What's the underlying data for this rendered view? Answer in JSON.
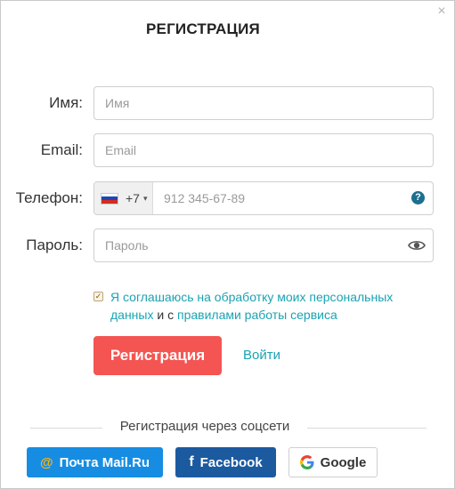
{
  "modal": {
    "title": "РЕГИСТРАЦИЯ",
    "close_icon": "×"
  },
  "form": {
    "name": {
      "label": "Имя:",
      "placeholder": "Имя",
      "value": ""
    },
    "email": {
      "label": "Email:",
      "placeholder": "Email",
      "value": ""
    },
    "phone": {
      "label": "Телефон:",
      "country_flag": "ru-flag-icon",
      "dial_code": "+7",
      "caret": "▾",
      "placeholder": "912 345-67-89",
      "value": "",
      "help_icon": "?"
    },
    "password": {
      "label": "Пароль:",
      "placeholder": "Пароль",
      "value": "",
      "toggle_icon": "eye-icon"
    }
  },
  "consent": {
    "checked": true,
    "check_mark": "✓",
    "link1": "Я соглашаюсь на обработку моих персональных данных",
    "middle": " и с ",
    "link2": "правилами работы сервиса"
  },
  "actions": {
    "register_label": "Регистрация",
    "login_label": "Войти"
  },
  "social": {
    "divider_label": "Регистрация через соцсети",
    "buttons": {
      "mailru": {
        "icon": "@",
        "label": "Почта Mail.Ru"
      },
      "facebook": {
        "icon": "f",
        "label": "Facebook"
      },
      "google": {
        "icon": "google-g-icon",
        "label": "Google"
      }
    }
  },
  "colors": {
    "accent": "#f45552",
    "link": "#1aa3b3",
    "mailru": "#168de2",
    "facebook": "#1c5aa0"
  }
}
